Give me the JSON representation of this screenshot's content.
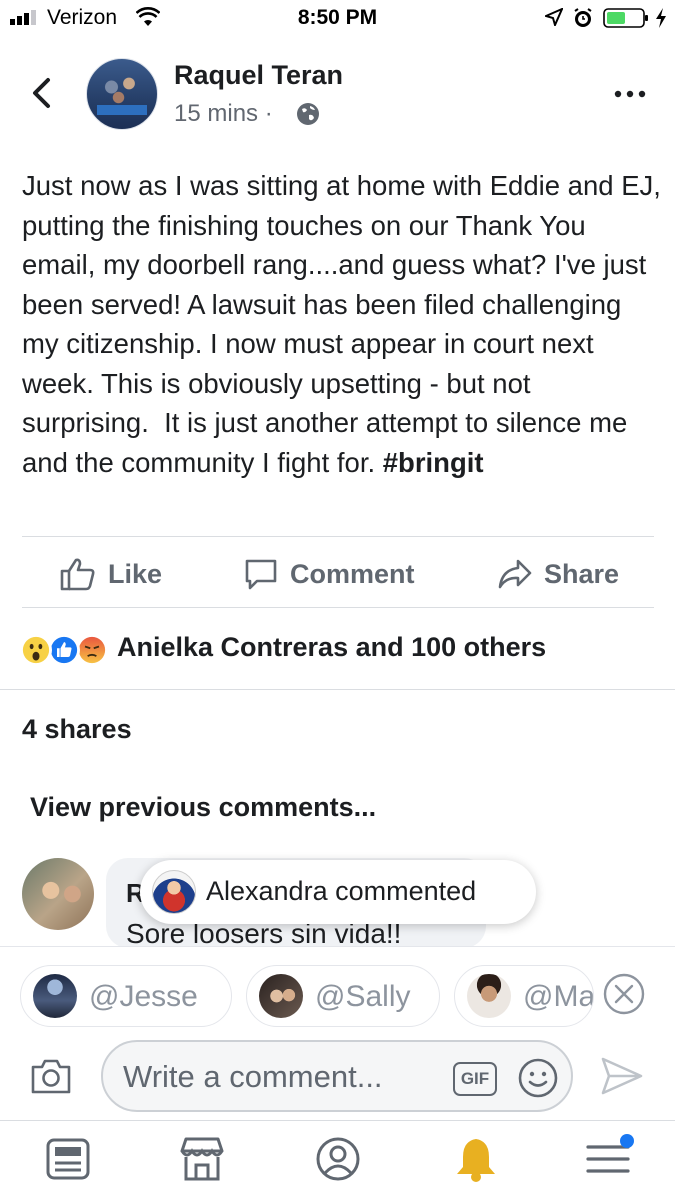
{
  "status_bar": {
    "carrier": "Verizon",
    "time": "8:50 PM",
    "battery_color": "#4cd964"
  },
  "post": {
    "author": "Raquel Teran",
    "time": "15 mins",
    "separator": "·",
    "privacy_icon": "globe-icon",
    "text": "Just now as I was sitting at home with Eddie and EJ, putting the finishing touches on our Thank You email, my doorbell rang....and guess what? I've just been served! A lawsuit has been filed challenging my citizenship. I now must appear in court next week. This is obviously upsetting - but not surprising.  It is just another attempt to silence me and the community I fight for.",
    "hashtag": "#bringit"
  },
  "actions": {
    "like": "Like",
    "comment": "Comment",
    "share": "Share"
  },
  "reactions": {
    "icons": [
      "wow-reaction-icon",
      "like-reaction-icon",
      "angry-reaction-icon"
    ],
    "summary": "Anielka Contreras and 100 others"
  },
  "shares": "4 shares",
  "view_previous": "View previous comments...",
  "comment": {
    "author_initial": "R",
    "text": "Sore loosers sin vida!!"
  },
  "toast": {
    "text": "Alexandra commented"
  },
  "mentions": [
    {
      "label": "@Jesse"
    },
    {
      "label": "@Sally"
    },
    {
      "label": "@Ma"
    }
  ],
  "composer": {
    "placeholder": "Write a comment...",
    "gif_label": "GIF"
  },
  "bottom_nav": [
    "news-feed-icon",
    "marketplace-icon",
    "profile-icon",
    "notifications-bell-icon",
    "menu-icon"
  ],
  "colors": {
    "fb_blue": "#1877f2",
    "bell_gold": "#e8b021",
    "text_gray": "#606770"
  }
}
